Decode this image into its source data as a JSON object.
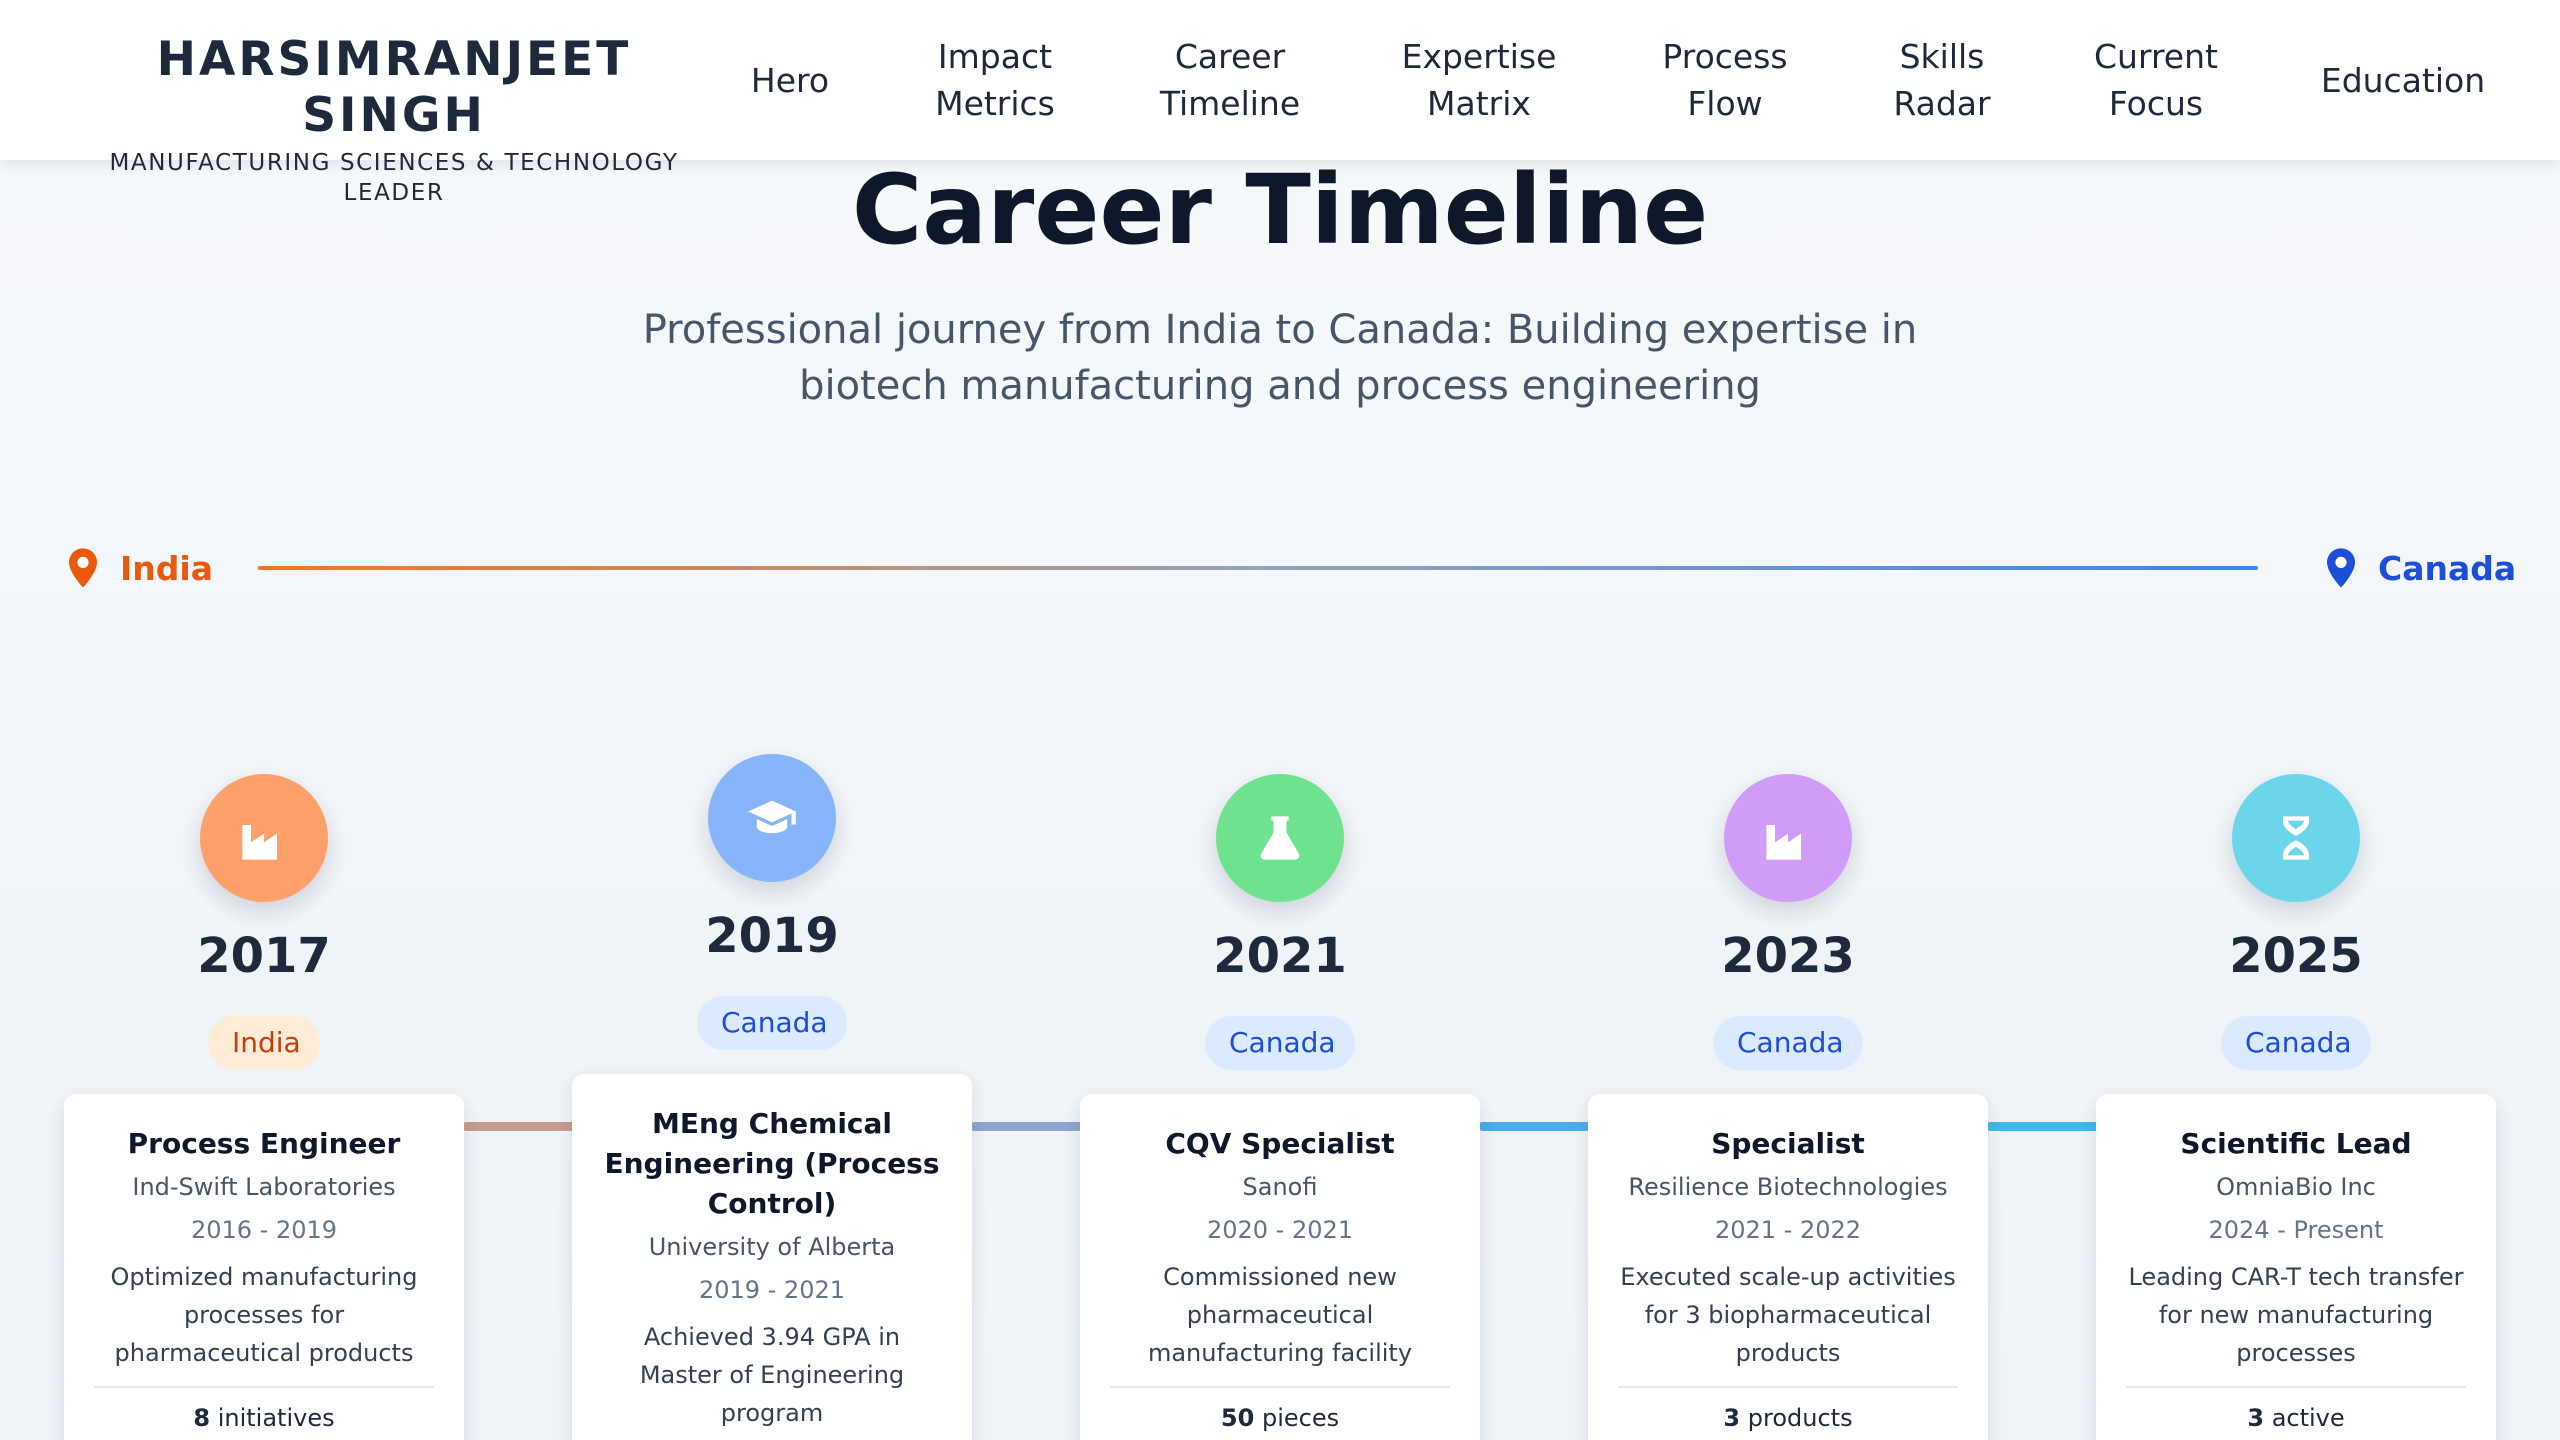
{
  "header": {
    "name": "HARSIMRANJEET SINGH",
    "tagline": "MANUFACTURING SCIENCES & TECHNOLOGY LEADER",
    "nav": [
      {
        "label": "Hero"
      },
      {
        "label": "Impact Metrics"
      },
      {
        "label": "Career Timeline"
      },
      {
        "label": "Expertise Matrix"
      },
      {
        "label": "Process Flow"
      },
      {
        "label": "Skills Radar"
      },
      {
        "label": "Current Focus"
      },
      {
        "label": "Education"
      }
    ]
  },
  "section": {
    "title": "Career Timeline",
    "subtitle": "Professional journey from India to Canada: Building expertise in biotech manufacturing and process engineering"
  },
  "journey": {
    "start": "India",
    "end": "Canada",
    "colors": {
      "india": "#ea580c",
      "canada": "#1d4ed8",
      "line_start": "#f97316",
      "line_end": "#3b82f6"
    }
  },
  "milestones": [
    {
      "year": "2017",
      "location": "India",
      "icon": "factory-icon",
      "icon_color": "#fda06b",
      "title": "Process Engineer",
      "org": "Ind-Swift Laboratories",
      "period": "2016 - 2019",
      "description": "Optimized manufacturing processes for pharmaceutical products",
      "metric_value": "8",
      "metric_unit": "initiatives"
    },
    {
      "year": "2019",
      "location": "Canada",
      "icon": "graduation-cap-icon",
      "icon_color": "#88b4f9",
      "title": "MEng Chemical Engineering (Process Control)",
      "org": "University of Alberta",
      "period": "2019 - 2021",
      "description": "Achieved 3.94 GPA in Master of Engineering program",
      "metric_value": "",
      "metric_unit": ""
    },
    {
      "year": "2021",
      "location": "Canada",
      "icon": "flask-icon",
      "icon_color": "#6ee28f",
      "title": "CQV Specialist",
      "org": "Sanofi",
      "period": "2020 - 2021",
      "description": "Commissioned new pharmaceutical manufacturing facility",
      "metric_value": "50",
      "metric_unit": "pieces"
    },
    {
      "year": "2023",
      "location": "Canada",
      "icon": "factory-icon",
      "icon_color": "#d19cf8",
      "title": "Specialist",
      "org": "Resilience Biotechnologies",
      "period": "2021 - 2022",
      "description": "Executed scale-up activities for 3 biopharmaceutical products",
      "metric_value": "3",
      "metric_unit": "products"
    },
    {
      "year": "2025",
      "location": "Canada",
      "icon": "dna-icon",
      "icon_color": "#6dd5e9",
      "title": "Scientific Lead",
      "org": "OmniaBio Inc",
      "period": "2024 - Present",
      "description": "Leading CAR-T tech transfer for new manufacturing processes",
      "metric_value": "3",
      "metric_unit": "active"
    }
  ]
}
